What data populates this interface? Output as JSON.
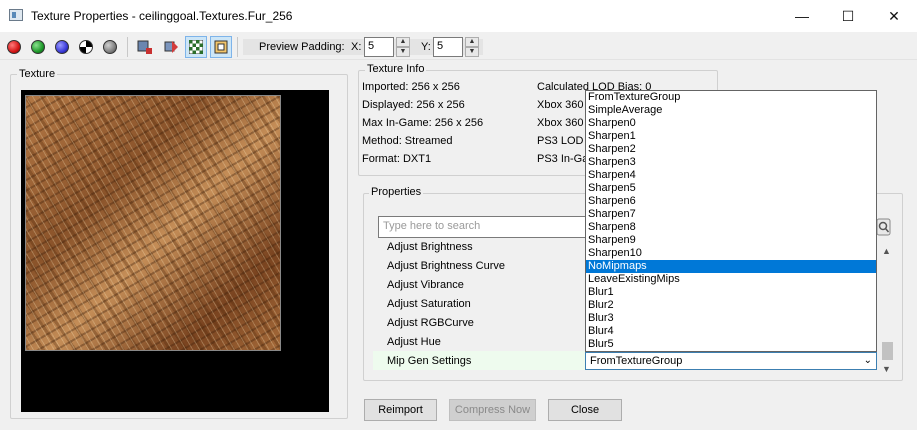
{
  "window": {
    "title": "Texture Properties - ceilinggoal.Textures.Fur_256",
    "minimize": "—",
    "maximize": "☐",
    "close": "✕"
  },
  "toolbar": {
    "channel_colors": [
      "#d41616",
      "#1e9a2a",
      "#3a3ad8"
    ],
    "preview_padding_label": "Preview Padding:",
    "x_label": "X:",
    "x_value": "5",
    "y_label": "Y:",
    "y_value": "5"
  },
  "texture_panel": {
    "title": "Texture"
  },
  "texture_info": {
    "title": "Texture Info",
    "left": [
      "Imported: 256 x 256",
      "Displayed: 256 x 256",
      "Max In-Game: 256 x 256",
      "Method: Streamed",
      "Format: DXT1"
    ],
    "right": [
      "Calculated LOD Bias: 0",
      "Xbox 360",
      "Xbox 360",
      "PS3 LOD B",
      "PS3 In-Ga"
    ]
  },
  "properties": {
    "title": "Properties",
    "search_placeholder": "Type here to search",
    "rows": [
      "Adjust Brightness",
      "Adjust Brightness Curve",
      "Adjust Vibrance",
      "Adjust Saturation",
      "Adjust RGBCurve",
      "Adjust Hue",
      "Mip Gen Settings"
    ],
    "mip_gen_value": "FromTextureGroup"
  },
  "dropdown": {
    "options": [
      "FromTextureGroup",
      "SimpleAverage",
      "Sharpen0",
      "Sharpen1",
      "Sharpen2",
      "Sharpen3",
      "Sharpen4",
      "Sharpen5",
      "Sharpen6",
      "Sharpen7",
      "Sharpen8",
      "Sharpen9",
      "Sharpen10",
      "NoMipmaps",
      "LeaveExistingMips",
      "Blur1",
      "Blur2",
      "Blur3",
      "Blur4",
      "Blur5"
    ],
    "highlighted": "NoMipmaps"
  },
  "buttons": {
    "reimport": "Reimport",
    "compress": "Compress Now",
    "close": "Close"
  }
}
